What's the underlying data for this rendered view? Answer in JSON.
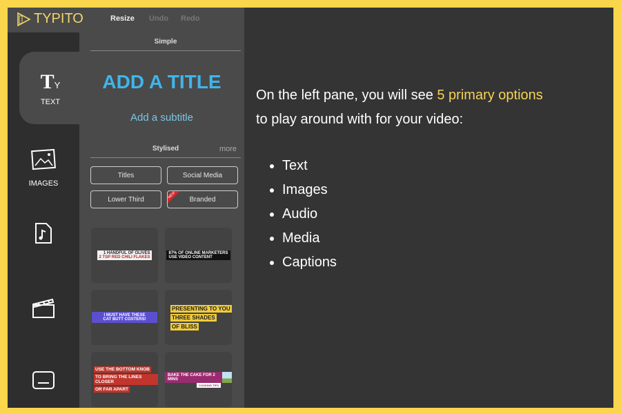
{
  "app": {
    "logo": "TYPITO"
  },
  "toolbar": {
    "resize": "Resize",
    "undo": "Undo",
    "redo": "Redo"
  },
  "sidebar": {
    "items": [
      {
        "label": "TEXT",
        "icon": "text-icon"
      },
      {
        "label": "IMAGES",
        "icon": "image-icon"
      },
      {
        "label": "",
        "icon": "audio-file-icon"
      },
      {
        "label": "",
        "icon": "clapperboard-icon"
      },
      {
        "label": "",
        "icon": "captions-icon"
      }
    ]
  },
  "panel": {
    "simple_label": "Simple",
    "title": "ADD A TITLE",
    "subtitle": "Add a subtitle",
    "stylised_label": "Stylised",
    "more": "more",
    "buttons": [
      "Titles",
      "Social Media",
      "Lower Third",
      "Branded"
    ],
    "new_badge": "NEW",
    "cards": [
      {
        "lines": [
          "1 HANDFUL OF OLIVES",
          "2 TSP RED CHILI FLAKES"
        ]
      },
      {
        "lines": [
          "87% OF ONLINE MARKETERS",
          "USE VIDEO CONTENT"
        ]
      },
      {
        "lines": [
          "I MUST HAVE THESE",
          "CAT BUTT COSTERS!"
        ]
      },
      {
        "lines": [
          "PRESENTING TO YOU",
          "THREE SHADES",
          "OF BLISS"
        ]
      },
      {
        "lines": [
          "USE THE BOTTOM KNOB",
          "TO BRING THE LINES CLOSER",
          "OR FAR APART"
        ]
      },
      {
        "lines": [
          "BAKE THE CAKE FOR 2 MINS",
          "COOKING TIPS"
        ]
      }
    ]
  },
  "content": {
    "intro_pre": "On the left pane, you will see ",
    "intro_highlight": "5 primary options",
    "intro_post": "to play around with for your video:",
    "list": [
      "Text",
      "Images",
      "Audio",
      "Media",
      "Captions"
    ]
  },
  "colors": {
    "border": "#f9d64b",
    "highlight": "#f7d354",
    "title": "#3fb5ea"
  }
}
